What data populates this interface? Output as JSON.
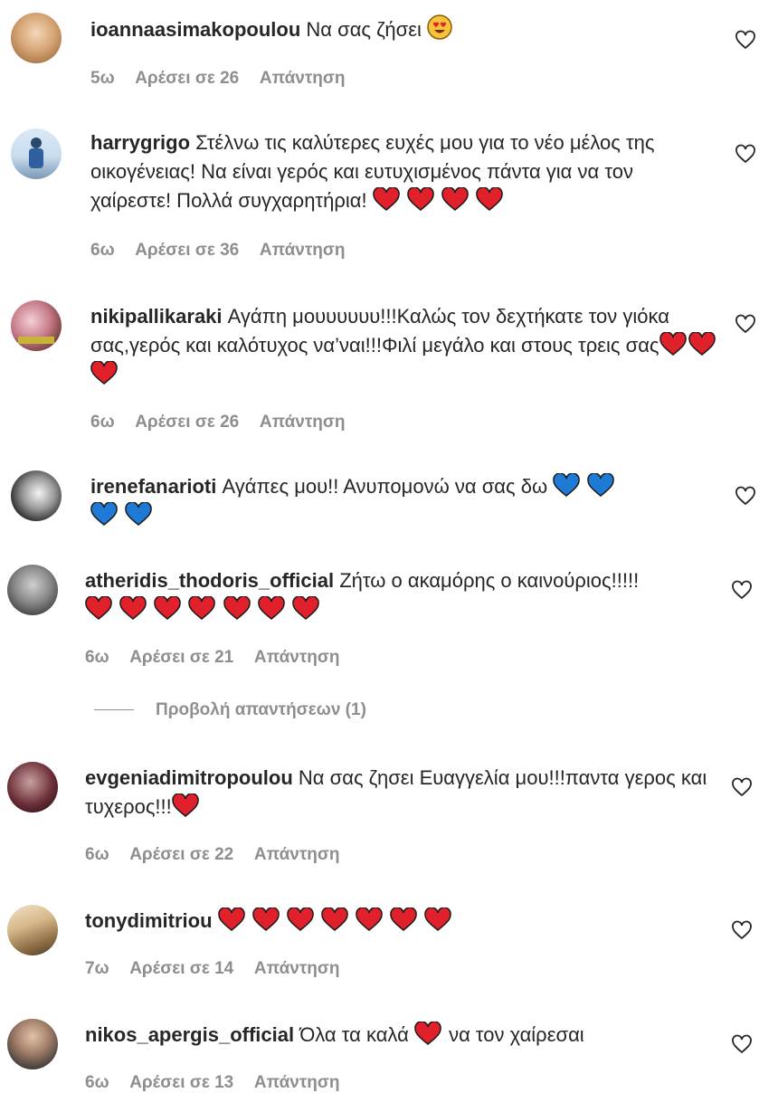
{
  "comments": [
    {
      "user": "ioannaasimakopoulou",
      "text": "Να σας ζήσει",
      "emojis": [
        "heart-eyes"
      ],
      "time": "5ω",
      "likes": "Αρέσει σε 26",
      "reply": "Απάντηση"
    },
    {
      "user": "harrygrigo",
      "text": "Στέλνω τις καλύτερες ευχές μου για το νέο μέλος της οικογένειας! Να είναι γερός και ευτυχισμένος πάντα για να τον χαίρεστε! Πολλά συγχαρητήρια!",
      "emojis": [
        "red-heart",
        "red-heart",
        "red-heart",
        "red-heart"
      ],
      "time": "6ω",
      "likes": "Αρέσει σε 36",
      "reply": "Απάντηση"
    },
    {
      "user": "nikipallikaraki",
      "text": "Αγάπη μουυυυυυ!!!Καλώς τον δεχτήκατε τον γιόκα σας,γερός και καλότυχος να’ναι!!!Φιλί μεγάλο και στους τρεις σας",
      "emojis": [
        "red-heart",
        "red-heart",
        "red-heart"
      ],
      "time": "6ω",
      "likes": "Αρέσει σε 26",
      "reply": "Απάντηση"
    },
    {
      "user": "irenefanarioti",
      "text": "Αγάπες μου!! Ανυπομονώ να σας δω",
      "emojis": [
        "blue-heart",
        "blue-heart",
        "blue-heart",
        "blue-heart"
      ],
      "time": "",
      "likes": "",
      "reply": ""
    },
    {
      "user": "atheridis_thodoris_official",
      "text": "Ζήτω ο ακαμόρης ο καινούριος!!!!!",
      "emojis": [
        "red-heart",
        "red-heart",
        "red-heart",
        "red-heart",
        "red-heart",
        "red-heart",
        "red-heart"
      ],
      "time": "6ω",
      "likes": "Αρέσει σε 21",
      "reply": "Απάντηση"
    },
    {
      "user": "evgeniadimitropoulou",
      "text": "Να σας ζησει Ευαγγελία μου!!!παντα γερος και τυχερος!!!",
      "emojis": [
        "red-heart"
      ],
      "time": "6ω",
      "likes": "Αρέσει σε 22",
      "reply": "Απάντηση"
    },
    {
      "user": "tonydimitriou",
      "text": "",
      "emojis": [
        "red-heart",
        "red-heart",
        "red-heart",
        "red-heart",
        "red-heart",
        "red-heart",
        "red-heart"
      ],
      "time": "7ω",
      "likes": "Αρέσει σε 14",
      "reply": "Απάντηση"
    },
    {
      "user": "nikos_apergis_official",
      "text": "Όλα τα καλά",
      "text_after": "να τον χαίρεσαι",
      "emojis": [
        "red-heart"
      ],
      "time": "6ω",
      "likes": "Αρέσει σε 13",
      "reply": "Απάντηση"
    }
  ],
  "view_replies": "Προβολή απαντήσεων (1)",
  "colors": {
    "text": "#262626",
    "muted": "#8e8e8e",
    "red_heart": "#e0202a",
    "blue_heart": "#1f7ad6"
  }
}
